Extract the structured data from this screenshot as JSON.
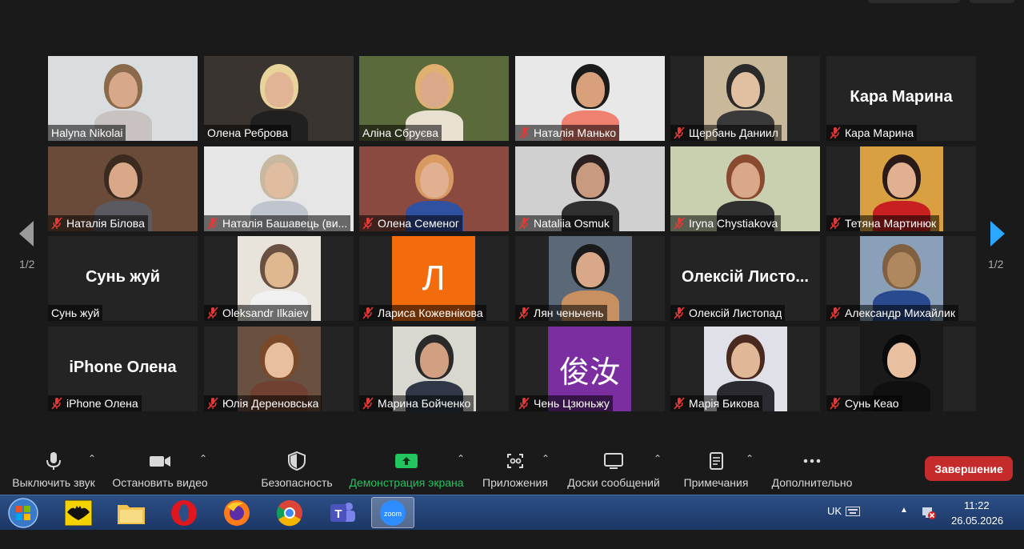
{
  "pager": {
    "left": "1/2",
    "right": "1/2"
  },
  "participants": [
    {
      "name": "Halyna Nikolai",
      "muted": false,
      "type": "video",
      "bg": "#d9dde0",
      "skin": "#d7a98a",
      "hair": "#8a6a4a",
      "cloth": "#c8c3c0"
    },
    {
      "name": "Олена Реброва",
      "muted": false,
      "type": "video",
      "bg": "#3a3430",
      "skin": "#e0b494",
      "hair": "#e8d39a",
      "cloth": "#202020"
    },
    {
      "name": "Аліна Сбруєва",
      "muted": false,
      "type": "video",
      "active": true,
      "bg": "#5a6a3a",
      "skin": "#d9a98a",
      "hair": "#e0b070",
      "cloth": "#e8e0d0"
    },
    {
      "name": "Наталія Манько",
      "muted": true,
      "type": "video",
      "bg": "#e8e8e8",
      "skin": "#d9a07c",
      "hair": "#1a1a1a",
      "cloth": "#f08070"
    },
    {
      "name": "Щербань Даниил",
      "muted": true,
      "type": "video-narrow",
      "bg": "#c9b89a",
      "skin": "#e0c0a0",
      "hair": "#2a2a2a",
      "cloth": "#3a3a3a"
    },
    {
      "name": "Кара Марина",
      "muted": true,
      "type": "text",
      "big": "Кара Марина"
    },
    {
      "name": "Наталія Білова",
      "muted": true,
      "type": "video",
      "bg": "#6a4a38",
      "skin": "#d8a888",
      "hair": "#3a2a20",
      "cloth": "#5a5a60"
    },
    {
      "name": "Наталія Башавець (ви...",
      "muted": true,
      "type": "video",
      "bg": "#e6e6e6",
      "skin": "#e0bca0",
      "hair": "#c8b8a0",
      "cloth": "#c0c4cc"
    },
    {
      "name": "Олена Семеног",
      "muted": true,
      "type": "video",
      "bg": "#8a4a40",
      "skin": "#e0b090",
      "hair": "#d89a60",
      "cloth": "#3050a0"
    },
    {
      "name": "Nataliia Osmuk",
      "muted": true,
      "type": "video",
      "bg": "#d0d0d0",
      "skin": "#c89a80",
      "hair": "#2a2020",
      "cloth": "#303030"
    },
    {
      "name": "Iryna Chystiakova",
      "muted": true,
      "type": "video",
      "bg": "#c8d0b0",
      "skin": "#d8a888",
      "hair": "#8a4a30",
      "cloth": "#303030"
    },
    {
      "name": "Тетяна Мартинюк",
      "muted": true,
      "type": "video-narrow",
      "bg": "#d8a040",
      "skin": "#e0b090",
      "hair": "#2a1a18",
      "cloth": "#c82020"
    },
    {
      "name": "Сунь жуй",
      "muted": false,
      "type": "text",
      "big": "Сунь жуй"
    },
    {
      "name": "Oleksandr Ilkaiev",
      "muted": true,
      "type": "video-narrow",
      "bg": "#e8e4dc",
      "skin": "#e0b890",
      "hair": "#6a5040",
      "cloth": "#f0f0f0"
    },
    {
      "name": "Лариса Кожевнікова",
      "muted": true,
      "type": "initial",
      "initial": "Л",
      "color": "#f26c0d"
    },
    {
      "name": "Лян ченьчень",
      "muted": true,
      "type": "video-narrow",
      "bg": "#5a6878",
      "skin": "#d8a888",
      "hair": "#1a1a1a",
      "cloth": "#c89060"
    },
    {
      "name": "Олексій Листопад",
      "muted": true,
      "type": "text",
      "big": "Олексій Листо..."
    },
    {
      "name": "Александр Михайлик",
      "muted": true,
      "type": "video-narrow",
      "bg": "#8aa0b8",
      "skin": "#b08860",
      "hair": "#806040",
      "cloth": "#2a4a90"
    },
    {
      "name": "iPhone Олена",
      "muted": true,
      "type": "text",
      "big": "iPhone Олена"
    },
    {
      "name": "Юлія Дереновська",
      "muted": true,
      "type": "video-narrow",
      "bg": "#6a5040",
      "skin": "#e8c0a0",
      "hair": "#7a4a28",
      "cloth": "#704030"
    },
    {
      "name": "Марина Бойченко",
      "muted": true,
      "type": "video-narrow",
      "bg": "#d8d8d0",
      "skin": "#d0a080",
      "hair": "#2a2a2a",
      "cloth": "#303848"
    },
    {
      "name": "Чень Цзюньжу",
      "muted": true,
      "type": "initial",
      "initial": "俊汝",
      "color": "#7a2ea0"
    },
    {
      "name": "Марія Бикова",
      "muted": true,
      "type": "video-narrow",
      "bg": "#e0e0e8",
      "skin": "#e0b898",
      "hair": "#4a2a20",
      "cloth": "#2a2a30"
    },
    {
      "name": "Сунь Кеао",
      "muted": true,
      "type": "video-narrow",
      "bg": "#1a1a1a",
      "skin": "#e8c0a0",
      "hair": "#0a0a0a",
      "cloth": "#101010"
    }
  ],
  "toolbar": {
    "mute": "Выключить звук",
    "video": "Остановить видео",
    "security": "Безопасность",
    "share": "Демонстрация экрана",
    "apps": "Приложения",
    "whiteboards": "Доски сообщений",
    "notes": "Примечания",
    "more": "Дополнительно",
    "end": "Завершение"
  },
  "taskbar": {
    "lang": "UK",
    "time": "11:22",
    "date": "26.05.2026",
    "zoom_label": "zoom"
  }
}
